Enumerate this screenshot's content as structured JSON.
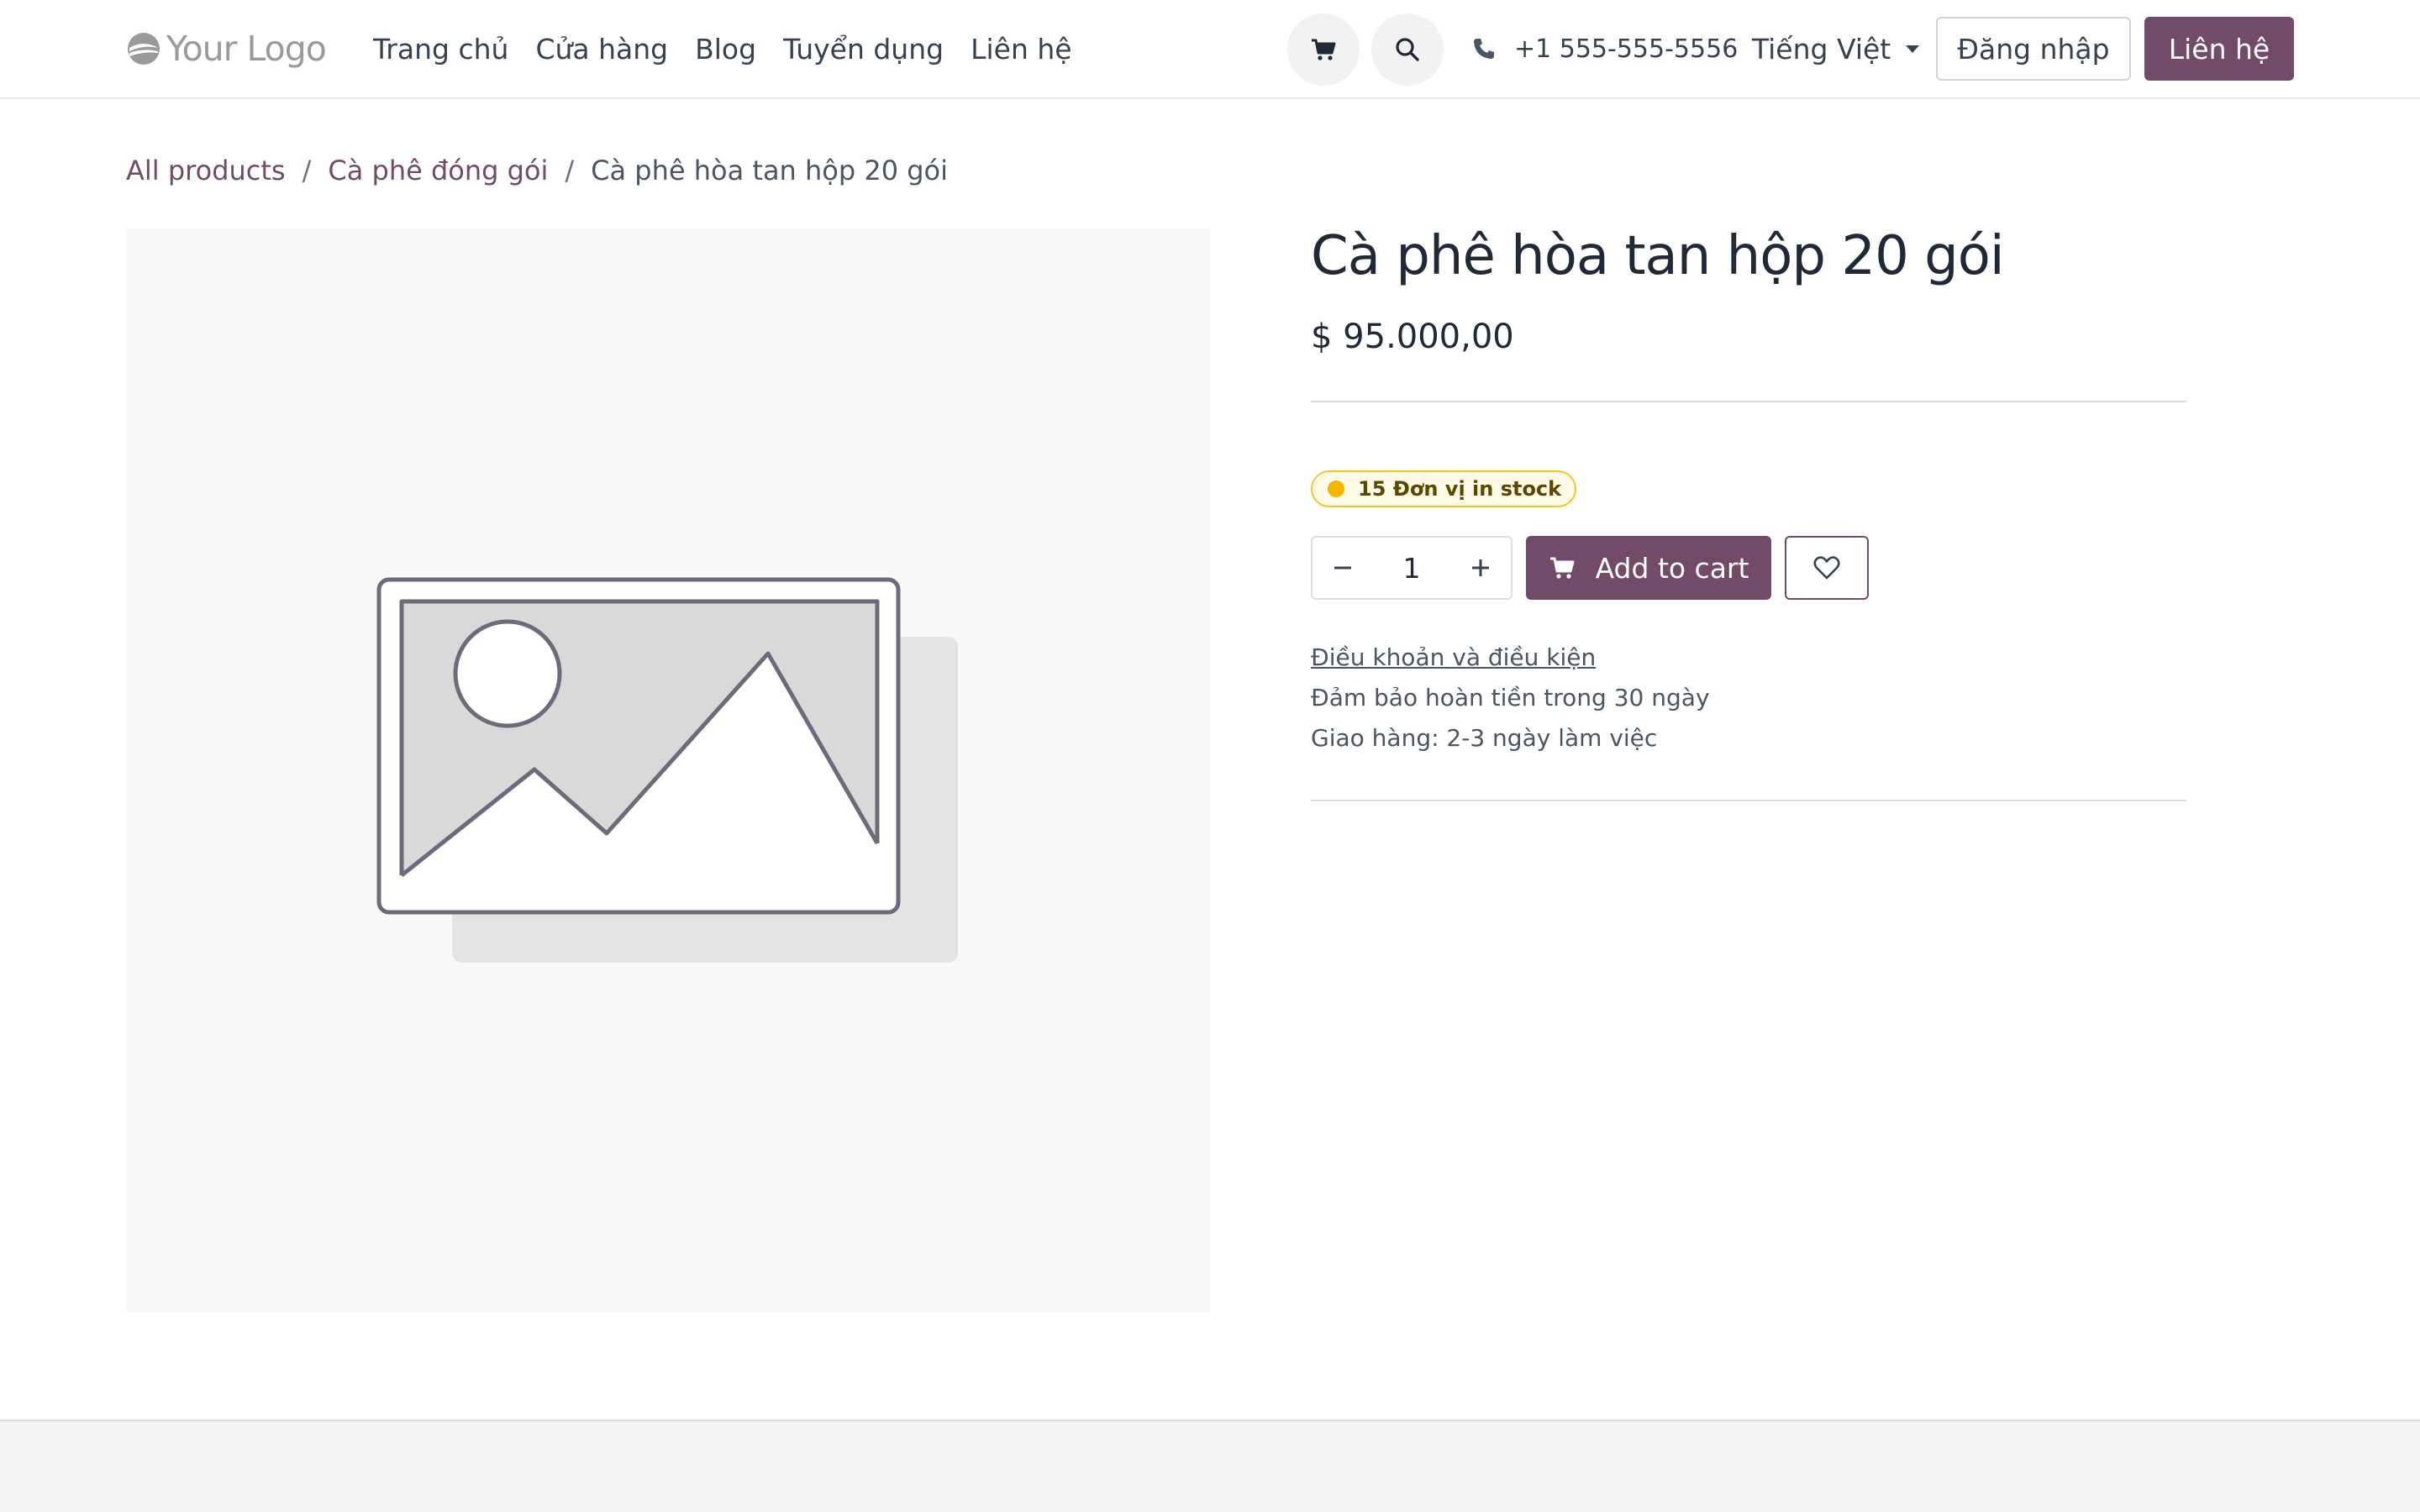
{
  "header": {
    "logo_text": "Your Logo",
    "nav": [
      "Trang chủ",
      "Cửa hàng",
      "Blog",
      "Tuyển dụng",
      "Liên hệ"
    ],
    "cart_icon": "shopping-cart-icon",
    "search_icon": "search-icon",
    "phone_icon": "phone-icon",
    "phone": "+1 555-555-5556",
    "language": "Tiếng Việt",
    "login_label": "Đăng nhập",
    "contact_label": "Liên hệ"
  },
  "breadcrumb": {
    "items": [
      "All products",
      "Cà phê đóng gói"
    ],
    "separator": "/",
    "current": "Cà phê hòa tan hộp 20 gói"
  },
  "product": {
    "title": "Cà phê hòa tan hộp 20 gói",
    "price": "$ 95.000,00",
    "stock_text": "15 Đơn vị in stock",
    "quantity": "1",
    "add_to_cart_label": "Add to cart",
    "terms_link": "Điều khoản và điều kiện",
    "guarantee": "Đảm bảo hoàn tiền trong 30 ngày",
    "shipping": "Giao hàng: 2-3 ngày làm việc",
    "image_icon": "image-placeholder-icon"
  },
  "colors": {
    "primary": "#714b67",
    "stock_dot": "#f4b400",
    "stock_border": "#f4c430"
  }
}
